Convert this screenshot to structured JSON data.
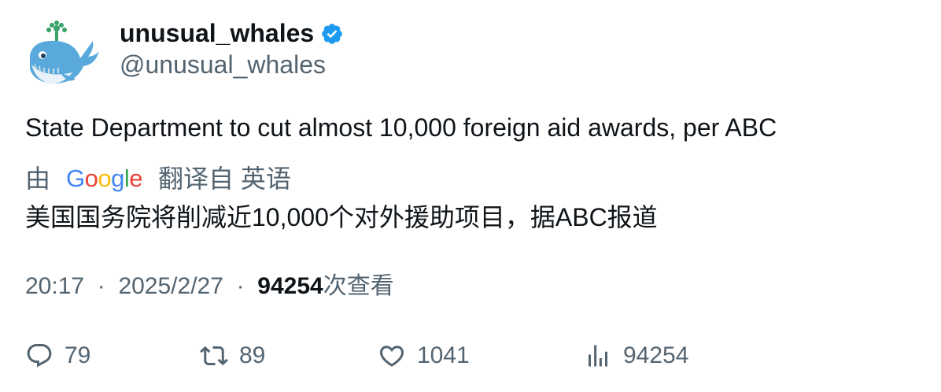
{
  "user": {
    "display_name": "unusual_whales",
    "handle": "@unusual_whales",
    "verified_badge": "verified-badge-icon",
    "avatar": "whale-avatar"
  },
  "tweet": {
    "text": "State Department to cut almost 10,000 foreign aid awards, per ABC",
    "translated_prefix": "由",
    "translator": "Google",
    "translated_suffix": "翻译自 英语",
    "translation": "美国国务院将削减近10,000个对外援助项目，据ABC报道"
  },
  "meta": {
    "time": "20:17",
    "separator": "·",
    "date": "2025/2/27",
    "views_count": "94254",
    "views_label": "次查看"
  },
  "actions": {
    "replies": "79",
    "retweets": "89",
    "likes": "1041",
    "views": "94254"
  },
  "colors": {
    "text_primary": "#0f1419",
    "text_secondary": "#536471",
    "verified_blue": "#1d9bf0",
    "google_blue": "#4285F4",
    "google_red": "#EA4335",
    "google_yellow": "#FBBC05",
    "google_green": "#34A853"
  }
}
